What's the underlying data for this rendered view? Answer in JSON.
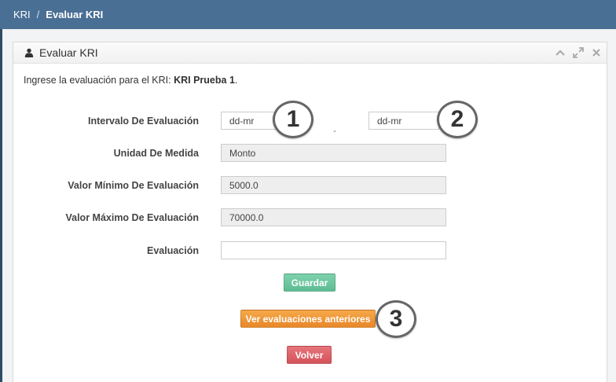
{
  "breadcrumb": {
    "root": "KRI",
    "separator": "/",
    "current": "Evaluar KRI"
  },
  "panel": {
    "title": "Evaluar KRI",
    "icons": [
      "user-icon",
      "chevron-up-icon",
      "expand-icon",
      "close-icon"
    ]
  },
  "intro": {
    "prefix": "Ingrese la evaluación para el KRI: ",
    "kri_name": "KRI Prueba 1",
    "suffix": "."
  },
  "form": {
    "interval": {
      "label": "Intervalo De Evaluación",
      "start_value": "dd-mr",
      "separator": "-",
      "end_value": "dd-mr"
    },
    "unit": {
      "label": "Unidad De Medida",
      "value": "Monto"
    },
    "min": {
      "label": "Valor Mínimo De Evaluación",
      "value": "5000.0"
    },
    "max": {
      "label": "Valor Máximo De Evaluación",
      "value": "70000.0"
    },
    "evaluation": {
      "label": "Evaluación",
      "value": ""
    }
  },
  "buttons": {
    "save": "Guardar",
    "history": "Ver evaluaciones anteriores",
    "back": "Volver"
  },
  "badges": [
    "1",
    "2",
    "3"
  ],
  "colors": {
    "topbar": "#4a6f95",
    "save": "#5dbd93",
    "history": "#e8872a",
    "back": "#d4535b"
  }
}
